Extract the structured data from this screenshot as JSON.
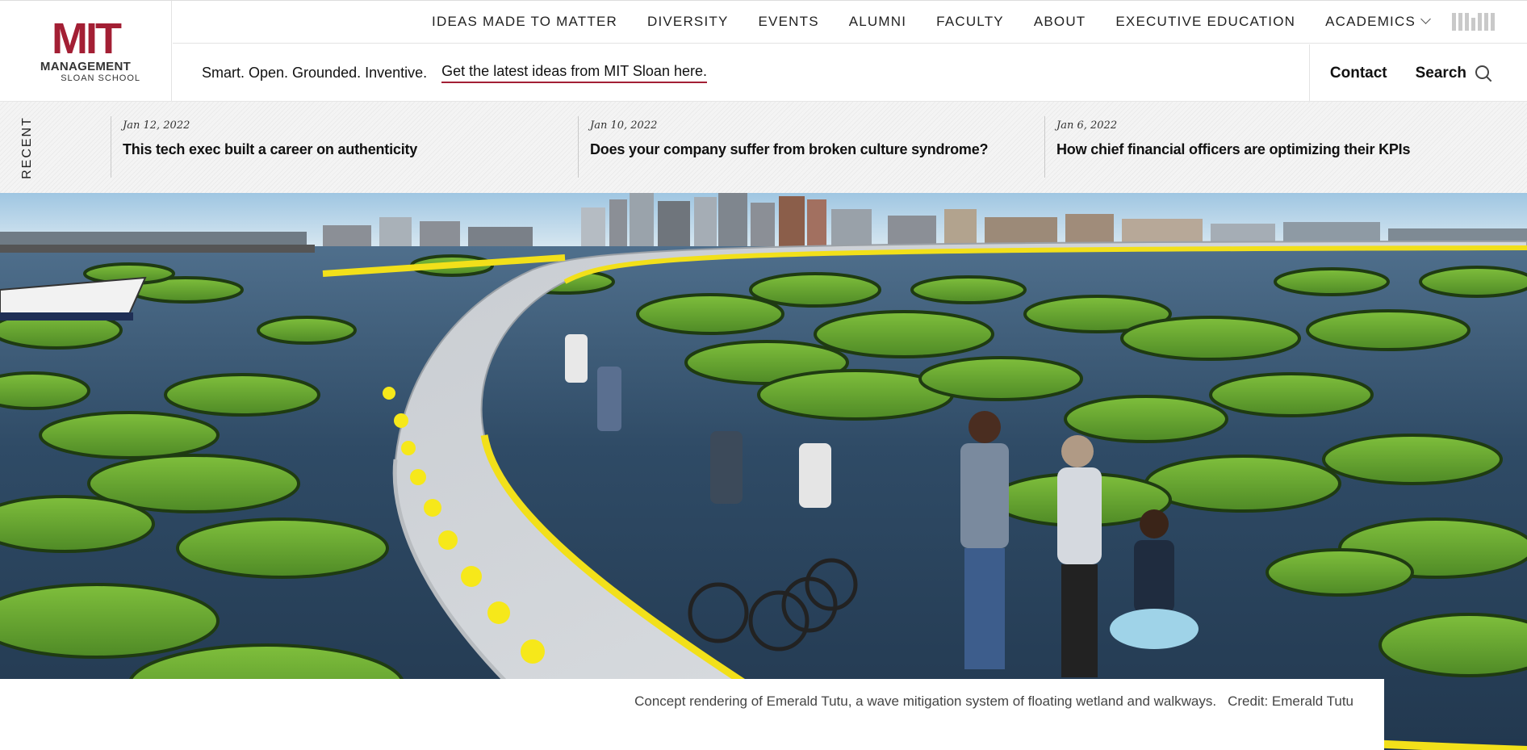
{
  "logo": {
    "mit": "MIT",
    "management": "MANAGEMENT",
    "school": "SLOAN SCHOOL"
  },
  "nav": {
    "items": [
      "IDEAS MADE TO MATTER",
      "DIVERSITY",
      "EVENTS",
      "ALUMNI",
      "FACULTY",
      "ABOUT",
      "EXECUTIVE EDUCATION",
      "ACADEMICS"
    ]
  },
  "subbar": {
    "tagline": "Smart. Open. Grounded. Inventive.",
    "link": "Get the latest ideas from MIT Sloan here.",
    "contact": "Contact",
    "search": "Search"
  },
  "recent": {
    "label": "RECENT",
    "items": [
      {
        "date": "Jan 12, 2022",
        "title": "This tech exec built a career on authenticity"
      },
      {
        "date": "Jan 10, 2022",
        "title": "Does your company suffer from broken culture syndrome?"
      },
      {
        "date": "Jan 6, 2022",
        "title": "How chief financial officers are optimizing their KPIs"
      }
    ]
  },
  "hero": {
    "caption": "Concept rendering of Emerald Tutu, a wave mitigation system of floating wetland and walkways.",
    "credit": "Credit: Emerald Tutu"
  },
  "colors": {
    "brand": "#a31f34",
    "walkway_rail": "#f2e01a",
    "water": "#2e4a66",
    "grass": "#5f9a2e"
  }
}
